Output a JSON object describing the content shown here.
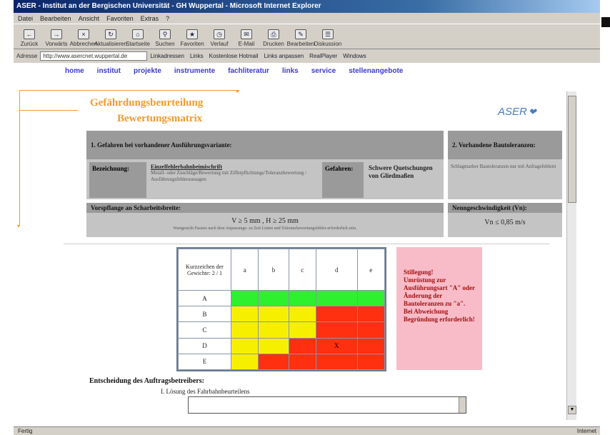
{
  "window": {
    "title": "ASER - Institut an der Bergischen Universität - GH Wuppertal - Microsoft Internet Explorer",
    "menu": [
      "Datei",
      "Bearbeiten",
      "Ansicht",
      "Favoriten",
      "Extras",
      "?"
    ],
    "toolbar": [
      "Zurück",
      "Vorwärts",
      "Abbrechen",
      "Aktualisieren",
      "Startseite",
      "Suchen",
      "Favoriten",
      "Verlauf",
      "E-Mail",
      "Drucken",
      "Bearbeiten",
      "Diskussion"
    ],
    "address_label": "Adresse",
    "address_value": "http://www.asercnet.wuppertal.de",
    "links": [
      "Linkadressen",
      "Links",
      "Kostenlose Hotmail",
      "Links anpassen",
      "RealPlayer",
      "Windows"
    ],
    "status_left": "Fertig",
    "status_right": "Internet"
  },
  "nav": [
    "home",
    "institut",
    "projekte",
    "instrumente",
    "fachliteratur",
    "links",
    "service",
    "stellenangebote"
  ],
  "page": {
    "title_line1": "Gefährdungsbeurteilung",
    "title_line2": "Bewertungsmatrix",
    "logo": "ASER",
    "section1_header": "1. Gefahren bei vorhandener Ausführungsvariante:",
    "section2_header": "2. Vorhandene Bautoleranzen:",
    "bezeichnung_label": "Bezeichnung:",
    "bezeichnung_value": "Einzelfehlerbahnbeimischrift",
    "bezeichnung_detail": "Metall- oder Zuschläge/Bewertung mit Zifferpflichtungs/Toleranzbewertung / Ausführungsfehleraussagen",
    "gefahren_label": "Gefahren:",
    "gefahren_value": "Schwere Quetschungen von Gliedmaßen",
    "toleranzen_value": "Schlagmarker Bautoleranzen nur mit Anfragefehlern",
    "vorspannung_header": "Vorspflange an Scharbeitsbreite:",
    "vorspannung_value": "V ≥ 5 mm , H ≥ 25 mm",
    "vorspannung_note": "Wartgesicht Passtes nach dem Anpassungs- zu Zeit Linien und Toleranzbewertungsfehler-erforderlich sein.",
    "nenngeschwindigkeit_header": "Nenngeschwindigkeit (Vn):",
    "nenngeschwindigkeit_value": "Vn ≤ 0,85 m/s",
    "decision_label": "Entscheidung des Auftragsbetreibers:",
    "solution_label": "I. Lösung des Fahrbahnbeurteilens"
  },
  "matrix": {
    "corner_label": "Kurzzeichen der Gewichte: 2 / 1",
    "columns": [
      "a",
      "b",
      "c",
      "d",
      "e"
    ],
    "rows": [
      {
        "label": "A",
        "cells": [
          "g",
          "g",
          "g",
          "g",
          "g"
        ],
        "mark": ""
      },
      {
        "label": "B",
        "cells": [
          "y",
          "y",
          "y",
          "r",
          "r"
        ],
        "mark": ""
      },
      {
        "label": "C",
        "cells": [
          "y",
          "y",
          "y",
          "r",
          "r"
        ],
        "mark": ""
      },
      {
        "label": "D",
        "cells": [
          "y",
          "y",
          "r",
          "r",
          "r"
        ],
        "mark": "X"
      },
      {
        "label": "E",
        "cells": [
          "y",
          "r",
          "r",
          "r",
          "r"
        ],
        "mark": ""
      }
    ],
    "mark_position": {
      "row": "D",
      "column": "d"
    },
    "colors": {
      "g": "#2ef02e",
      "y": "#f6f000",
      "r": "#ff3010"
    }
  },
  "warning": {
    "title": "Stillegung!",
    "text": "Umrüstung zur Ausführungsart \"A\" oder Änderung der Bautoleranzen zu \"a\". Bei Abweichung Begründung erforderlich!"
  }
}
